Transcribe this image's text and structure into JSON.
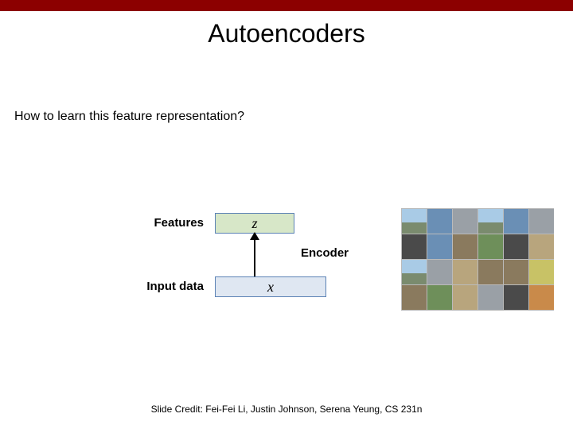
{
  "slide": {
    "title": "Autoencoders",
    "question": "How to learn this feature representation?",
    "diagram": {
      "features_label": "Features",
      "input_label": "Input data",
      "encoder_label": "Encoder",
      "z_var": "z",
      "x_var": "x"
    },
    "image_grid": {
      "rows": 4,
      "cols": 6,
      "cell_classes": [
        "sky",
        "blue",
        "gray",
        "sky",
        "blue",
        "gray",
        "drk",
        "blue",
        "brn",
        "grn",
        "drk",
        "tan",
        "sky",
        "gray",
        "tan",
        "brn",
        "brn",
        "ylw",
        "brn",
        "grn",
        "tan",
        "gray",
        "drk",
        "org"
      ]
    },
    "credit": "Slide Credit: Fei-Fei Li, Justin Johnson, Serena Yeung, CS 231n"
  }
}
